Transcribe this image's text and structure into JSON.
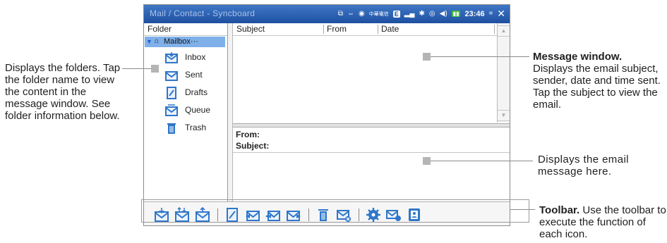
{
  "window": {
    "title": "Mail / Contact - Syncboard",
    "status": {
      "carrier": "中華電信",
      "network_icon": "E",
      "time": "23:46"
    }
  },
  "folder_pane": {
    "header": "Folder",
    "mailbox": "Mailbox···",
    "folders": [
      {
        "label": "Inbox",
        "icon": "inbox-icon"
      },
      {
        "label": "Sent",
        "icon": "sent-icon"
      },
      {
        "label": "Drafts",
        "icon": "drafts-icon"
      },
      {
        "label": "Queue",
        "icon": "queue-icon"
      },
      {
        "label": "Trash",
        "icon": "trash-icon"
      }
    ]
  },
  "message_list": {
    "columns": [
      "Subject",
      "From",
      "Date"
    ]
  },
  "preview": {
    "from_label": "From:",
    "subject_label": "Subject:"
  },
  "toolbar": {
    "icons": [
      "receive-mail-icon",
      "send-receive-icon",
      "send-mail-icon",
      "compose-icon",
      "reply-icon",
      "reply-all-icon",
      "forward-icon",
      "delete-icon",
      "delete-mail-icon",
      "settings-icon",
      "account-icon",
      "contacts-icon"
    ]
  },
  "colors": {
    "titlebar": "#2a5fb3",
    "selection": "#7fb0ea",
    "icon_blue": "#2f76c9"
  },
  "annotations": {
    "folders": "Displays the folders. Tap the folder name to view the content in the message window. See folder information below.",
    "message_title": "Message window.",
    "message_body": "Displays the email subject, sender, date and time sent. Tap the subject to view the email.",
    "preview_body": "Displays the email message here.",
    "toolbar_title": "Toolbar.",
    "toolbar_body": "Use the toolbar to execute the function of each icon."
  }
}
